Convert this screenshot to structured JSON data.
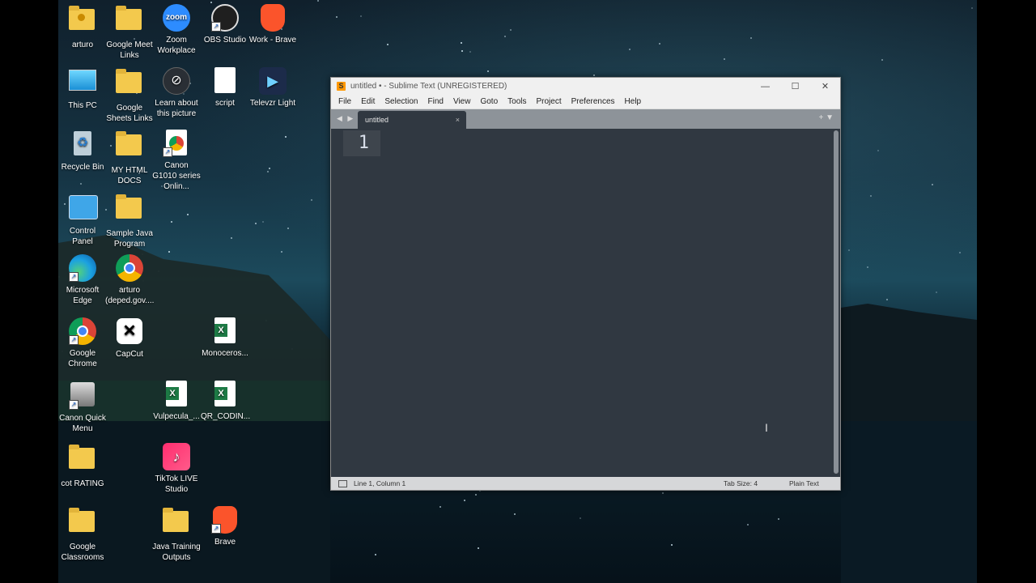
{
  "desktop": {
    "icons": [
      {
        "label": "arturo",
        "icon": "user-folder-icon"
      },
      {
        "label": "Google Meet Links",
        "icon": "folder-icon"
      },
      {
        "label": "Zoom Workplace",
        "icon": "zoom-icon",
        "glyph_text": "zoom"
      },
      {
        "label": "OBS Studio",
        "icon": "obs-icon"
      },
      {
        "label": "Work - Brave",
        "icon": "brave-icon"
      },
      {
        "label": "This PC",
        "icon": "monitor-icon"
      },
      {
        "label": "Google Sheets Links",
        "icon": "folder-icon"
      },
      {
        "label": "Learn about this picture",
        "icon": "learn-icon"
      },
      {
        "label": "script",
        "icon": "document-icon"
      },
      {
        "label": "Televzr Light",
        "icon": "televzr-icon"
      },
      {
        "label": "Recycle Bin",
        "icon": "recycle-bin-icon"
      },
      {
        "label": "MY HTML DOCS",
        "icon": "folder-icon"
      },
      {
        "label": "Canon G1010 series Onlin...",
        "icon": "chrome-icon"
      },
      {
        "label": "Control Panel",
        "icon": "control-panel-icon"
      },
      {
        "label": "Sample Java Program",
        "icon": "folder-icon"
      },
      {
        "label": "Microsoft Edge",
        "icon": "edge-icon"
      },
      {
        "label": "arturo (deped.gov....",
        "icon": "chrome-icon"
      },
      {
        "label": "Google Chrome",
        "icon": "chrome-icon"
      },
      {
        "label": "CapCut",
        "icon": "capcut-icon"
      },
      {
        "label": "Monoceros...",
        "icon": "excel-icon",
        "glyph_text": "X"
      },
      {
        "label": "Canon Quick Menu",
        "icon": "canon-icon"
      },
      {
        "label": "Vulpecula_...",
        "icon": "excel-icon",
        "glyph_text": "X"
      },
      {
        "label": "QR_CODIN...",
        "icon": "excel-icon",
        "glyph_text": "X"
      },
      {
        "label": "cot RATING",
        "icon": "folder-icon"
      },
      {
        "label": "TikTok LIVE Studio",
        "icon": "tiktok-icon"
      },
      {
        "label": "Google Classrooms",
        "icon": "folder-icon"
      },
      {
        "label": "Java Training Outputs",
        "icon": "folder-icon"
      },
      {
        "label": "Brave",
        "icon": "brave-icon"
      }
    ]
  },
  "window": {
    "title": "untitled • - Sublime Text (UNREGISTERED)",
    "logo_text": "S",
    "controls": {
      "minimize": "—",
      "maximize": "☐",
      "close": "✕"
    },
    "menu": [
      "File",
      "Edit",
      "Selection",
      "Find",
      "View",
      "Goto",
      "Tools",
      "Project",
      "Preferences",
      "Help"
    ],
    "tab": {
      "label": "untitled",
      "close": "×"
    },
    "tab_nav": "◀ ▶",
    "tab_actions": "+ ▼",
    "editor": {
      "line_number": "1",
      "cursor_glyph": "I"
    },
    "status": {
      "position": "Line 1, Column 1",
      "tab_size": "Tab Size: 4",
      "syntax": "Plain Text"
    }
  }
}
